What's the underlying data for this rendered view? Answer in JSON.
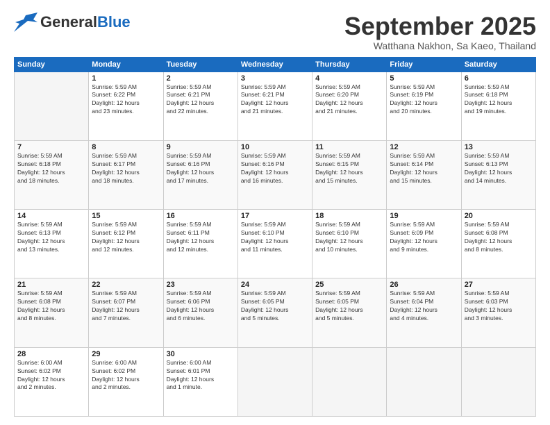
{
  "header": {
    "logo_general": "General",
    "logo_blue": "Blue",
    "month_title": "September 2025",
    "location": "Watthana Nakhon, Sa Kaeo, Thailand"
  },
  "days_of_week": [
    "Sunday",
    "Monday",
    "Tuesday",
    "Wednesday",
    "Thursday",
    "Friday",
    "Saturday"
  ],
  "weeks": [
    [
      {
        "day": "",
        "info": ""
      },
      {
        "day": "1",
        "info": "Sunrise: 5:59 AM\nSunset: 6:22 PM\nDaylight: 12 hours\nand 23 minutes."
      },
      {
        "day": "2",
        "info": "Sunrise: 5:59 AM\nSunset: 6:21 PM\nDaylight: 12 hours\nand 22 minutes."
      },
      {
        "day": "3",
        "info": "Sunrise: 5:59 AM\nSunset: 6:21 PM\nDaylight: 12 hours\nand 21 minutes."
      },
      {
        "day": "4",
        "info": "Sunrise: 5:59 AM\nSunset: 6:20 PM\nDaylight: 12 hours\nand 21 minutes."
      },
      {
        "day": "5",
        "info": "Sunrise: 5:59 AM\nSunset: 6:19 PM\nDaylight: 12 hours\nand 20 minutes."
      },
      {
        "day": "6",
        "info": "Sunrise: 5:59 AM\nSunset: 6:18 PM\nDaylight: 12 hours\nand 19 minutes."
      }
    ],
    [
      {
        "day": "7",
        "info": "Sunrise: 5:59 AM\nSunset: 6:18 PM\nDaylight: 12 hours\nand 18 minutes."
      },
      {
        "day": "8",
        "info": "Sunrise: 5:59 AM\nSunset: 6:17 PM\nDaylight: 12 hours\nand 18 minutes."
      },
      {
        "day": "9",
        "info": "Sunrise: 5:59 AM\nSunset: 6:16 PM\nDaylight: 12 hours\nand 17 minutes."
      },
      {
        "day": "10",
        "info": "Sunrise: 5:59 AM\nSunset: 6:16 PM\nDaylight: 12 hours\nand 16 minutes."
      },
      {
        "day": "11",
        "info": "Sunrise: 5:59 AM\nSunset: 6:15 PM\nDaylight: 12 hours\nand 15 minutes."
      },
      {
        "day": "12",
        "info": "Sunrise: 5:59 AM\nSunset: 6:14 PM\nDaylight: 12 hours\nand 15 minutes."
      },
      {
        "day": "13",
        "info": "Sunrise: 5:59 AM\nSunset: 6:13 PM\nDaylight: 12 hours\nand 14 minutes."
      }
    ],
    [
      {
        "day": "14",
        "info": "Sunrise: 5:59 AM\nSunset: 6:13 PM\nDaylight: 12 hours\nand 13 minutes."
      },
      {
        "day": "15",
        "info": "Sunrise: 5:59 AM\nSunset: 6:12 PM\nDaylight: 12 hours\nand 12 minutes."
      },
      {
        "day": "16",
        "info": "Sunrise: 5:59 AM\nSunset: 6:11 PM\nDaylight: 12 hours\nand 12 minutes."
      },
      {
        "day": "17",
        "info": "Sunrise: 5:59 AM\nSunset: 6:10 PM\nDaylight: 12 hours\nand 11 minutes."
      },
      {
        "day": "18",
        "info": "Sunrise: 5:59 AM\nSunset: 6:10 PM\nDaylight: 12 hours\nand 10 minutes."
      },
      {
        "day": "19",
        "info": "Sunrise: 5:59 AM\nSunset: 6:09 PM\nDaylight: 12 hours\nand 9 minutes."
      },
      {
        "day": "20",
        "info": "Sunrise: 5:59 AM\nSunset: 6:08 PM\nDaylight: 12 hours\nand 8 minutes."
      }
    ],
    [
      {
        "day": "21",
        "info": "Sunrise: 5:59 AM\nSunset: 6:08 PM\nDaylight: 12 hours\nand 8 minutes."
      },
      {
        "day": "22",
        "info": "Sunrise: 5:59 AM\nSunset: 6:07 PM\nDaylight: 12 hours\nand 7 minutes."
      },
      {
        "day": "23",
        "info": "Sunrise: 5:59 AM\nSunset: 6:06 PM\nDaylight: 12 hours\nand 6 minutes."
      },
      {
        "day": "24",
        "info": "Sunrise: 5:59 AM\nSunset: 6:05 PM\nDaylight: 12 hours\nand 5 minutes."
      },
      {
        "day": "25",
        "info": "Sunrise: 5:59 AM\nSunset: 6:05 PM\nDaylight: 12 hours\nand 5 minutes."
      },
      {
        "day": "26",
        "info": "Sunrise: 5:59 AM\nSunset: 6:04 PM\nDaylight: 12 hours\nand 4 minutes."
      },
      {
        "day": "27",
        "info": "Sunrise: 5:59 AM\nSunset: 6:03 PM\nDaylight: 12 hours\nand 3 minutes."
      }
    ],
    [
      {
        "day": "28",
        "info": "Sunrise: 6:00 AM\nSunset: 6:02 PM\nDaylight: 12 hours\nand 2 minutes."
      },
      {
        "day": "29",
        "info": "Sunrise: 6:00 AM\nSunset: 6:02 PM\nDaylight: 12 hours\nand 2 minutes."
      },
      {
        "day": "30",
        "info": "Sunrise: 6:00 AM\nSunset: 6:01 PM\nDaylight: 12 hours\nand 1 minute."
      },
      {
        "day": "",
        "info": ""
      },
      {
        "day": "",
        "info": ""
      },
      {
        "day": "",
        "info": ""
      },
      {
        "day": "",
        "info": ""
      }
    ]
  ]
}
